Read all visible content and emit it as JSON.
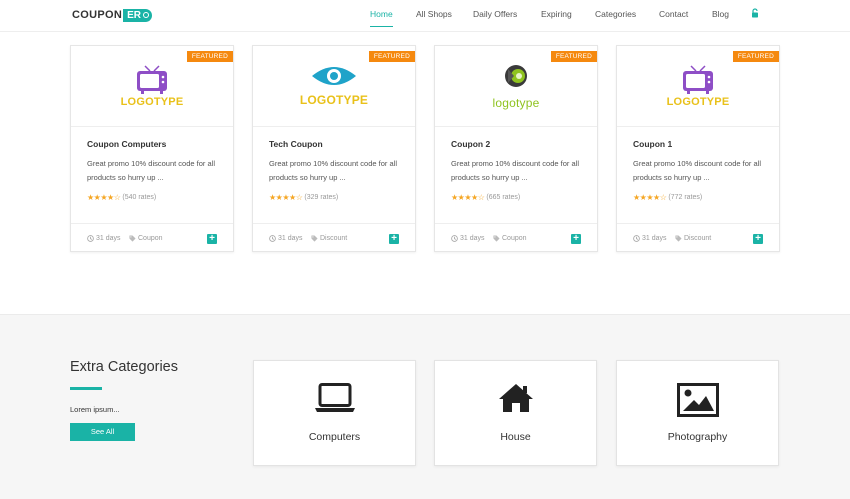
{
  "brand": {
    "name_main": "COUPON",
    "name_pill": "ER"
  },
  "nav": {
    "items": [
      "Home",
      "All Shops",
      "Daily Offers",
      "Expiring",
      "Categories",
      "Contact",
      "Blog"
    ],
    "active": "Home"
  },
  "cards": [
    {
      "badge": "FEATURED",
      "logo_text": "LOGOTYPE",
      "logo_icon": "tv-icon",
      "title": "Coupon Computers",
      "desc": "Great promo 10% discount code for all products so hurry up ...",
      "rates": "(540 rates)",
      "rating": 4,
      "days": "31 days",
      "tag": "Coupon"
    },
    {
      "badge": "FEATURED",
      "logo_text": "LOGOTYPE",
      "logo_icon": "eye-icon",
      "title": "Tech Coupon",
      "desc": "Great promo 10% discount code for all products so hurry up ...",
      "rates": "(329 rates)",
      "rating": 4,
      "days": "31 days",
      "tag": "Discount"
    },
    {
      "badge": "FEATURED",
      "logo_text": "logotype",
      "logo_icon": "speaker-icon",
      "title": "Coupon 2",
      "desc": "Great promo 10% discount code for all products so hurry up ...",
      "rates": "(665 rates)",
      "rating": 4,
      "days": "31 days",
      "tag": "Coupon"
    },
    {
      "badge": "FEATURED",
      "logo_text": "LOGOTYPE",
      "logo_icon": "tv-icon",
      "title": "Coupon 1",
      "desc": "Great promo 10% discount code for all products so hurry up ...",
      "rates": "(772 rates)",
      "rating": 4,
      "days": "31 days",
      "tag": "Discount"
    }
  ],
  "extra": {
    "title": "Extra Categories",
    "lorem": "Lorem ipsum...",
    "button": "See All",
    "categories": [
      {
        "label": "Computers",
        "icon": "laptop-icon"
      },
      {
        "label": "House",
        "icon": "house-icon"
      },
      {
        "label": "Photography",
        "icon": "picture-icon"
      }
    ]
  },
  "colors": {
    "accent": "#1ab3a6",
    "badge": "#f5890f",
    "stars": "#f5a623",
    "logo_gold": "#e9c11a",
    "logo_purple": "#8e4ec6",
    "logo_blue": "#1fa3c9"
  }
}
